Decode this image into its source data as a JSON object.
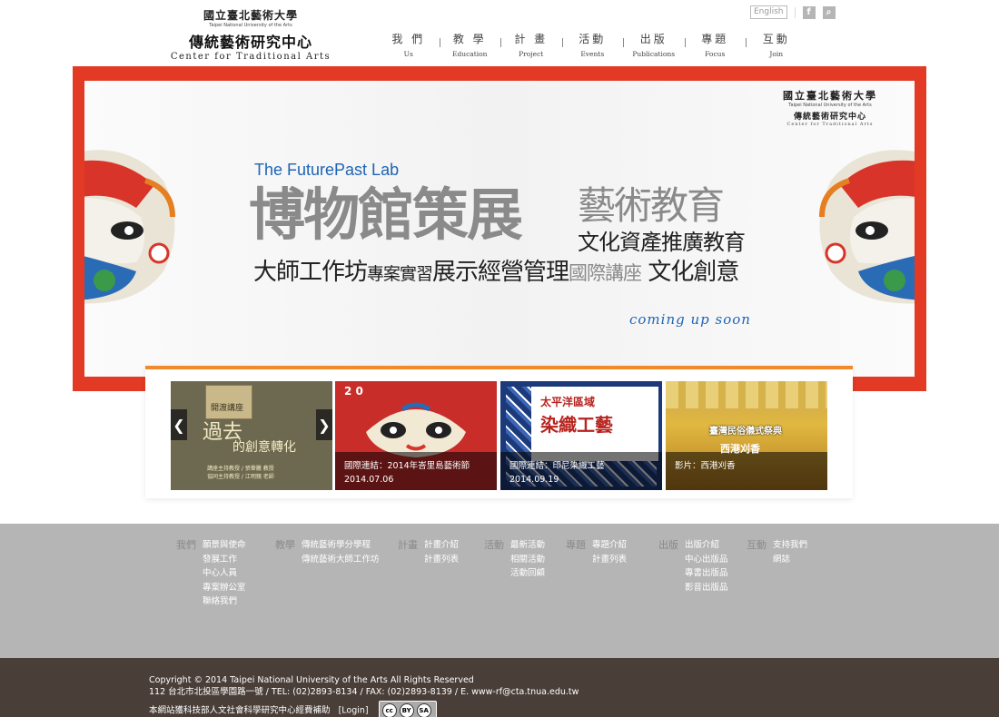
{
  "header": {
    "logo": {
      "university_zh": "國立臺北藝術大學",
      "university_en": "Taipei National University of the Arts",
      "center_zh": "傳統藝術研究中心",
      "center_en": "Center for Traditional Arts"
    },
    "nav": [
      {
        "zh": "我 們",
        "en": "Us"
      },
      {
        "zh": "教 學",
        "en": "Education"
      },
      {
        "zh": "計 畫",
        "en": "Project"
      },
      {
        "zh": "活動",
        "en": "Events"
      },
      {
        "zh": "出版",
        "en": "Publications"
      },
      {
        "zh": "專題",
        "en": "Focus"
      },
      {
        "zh": "互動",
        "en": "Join"
      }
    ],
    "language_button": "English",
    "facebook_icon_glyph": "f",
    "search_icon_glyph": "⌕"
  },
  "banner": {
    "logo": {
      "university_zh": "國立臺北藝術大學",
      "university_en": "Taipei National University of the Arts",
      "center_zh": "傳統藝術研究中心",
      "center_en": "Center for Traditional Arts"
    },
    "lab_title": "The FuturePast Lab",
    "line1_big": "博物館策展",
    "line1_right": "藝術教育",
    "line2": "文化資產推廣教育",
    "line3_a": "大師工作坊",
    "line3_b": "專案實習",
    "line3_c": "展示經營管理",
    "line3_d": "國際講座",
    "line3_e": "文化創意",
    "coming_soon": "coming up soon"
  },
  "carousel": {
    "slides": [
      {
        "caption_line1": "",
        "caption_line2": "",
        "art_title": "過去",
        "art_subtitle": "的創意轉化",
        "art_tag": "開渡講座",
        "art_credits": "講座主持教授 / 張譽騰 教授\n協同主持教授 / 江明親 老師"
      },
      {
        "caption_line1": "國際連結：2014年峇里島藝術節",
        "caption_line2": "2014.07.06",
        "art_digits": "2 0"
      },
      {
        "caption_line1": "國際連結：印尼染織工藝",
        "caption_line2": "2014.09.19",
        "art_title": "太平洋區域",
        "art_subtitle": "染織工藝"
      },
      {
        "caption_line1": "影片：西港刈香",
        "caption_line2": "",
        "art_title": "臺灣民俗儀式祭典",
        "art_subtitle": "西港刈香"
      }
    ],
    "prev_glyph": "❮",
    "next_glyph": "❯"
  },
  "footer_nav": [
    {
      "heading": "我們",
      "links": [
        "願景與使命",
        "發展工作",
        "中心人員",
        "專案辦公室",
        "聯絡我們"
      ]
    },
    {
      "heading": "教學",
      "links": [
        "傳統藝術學分學程",
        "傳統藝術大師工作坊"
      ]
    },
    {
      "heading": "計畫",
      "links": [
        "計畫介紹",
        "計畫列表"
      ]
    },
    {
      "heading": "活動",
      "links": [
        "最新活動",
        "相關活動",
        "活動回顧"
      ]
    },
    {
      "heading": "專題",
      "links": [
        "專題介紹",
        "計畫列表"
      ]
    },
    {
      "heading": "出版",
      "links": [
        "出版介紹",
        "中心出版品",
        "專書出版品",
        "影音出版品"
      ]
    },
    {
      "heading": "互動",
      "links": [
        "支持我們",
        "網誌"
      ]
    }
  ],
  "footer_bottom": {
    "copyright": "Copyright © 2014 Taipei National University of the Arts All Rights Reserved",
    "address": "112 台北市北投區學園路一號 / TEL: (02)2893-8134 / FAX: (02)2893-8139 / E. www-rf@cta.tnua.edu.tw",
    "funding": "本網站獲科技部人文社會科學研究中心經費補助",
    "login": "[Login]",
    "cc_label": "cc",
    "cc_by": "BY",
    "cc_sa": "SA"
  },
  "colors": {
    "banner_red": "#e23a24",
    "accent_orange": "#f18a2b",
    "lab_blue": "#1e64b5",
    "footer_gray": "#b5b5b5",
    "footer_brown": "#4a3e38"
  }
}
